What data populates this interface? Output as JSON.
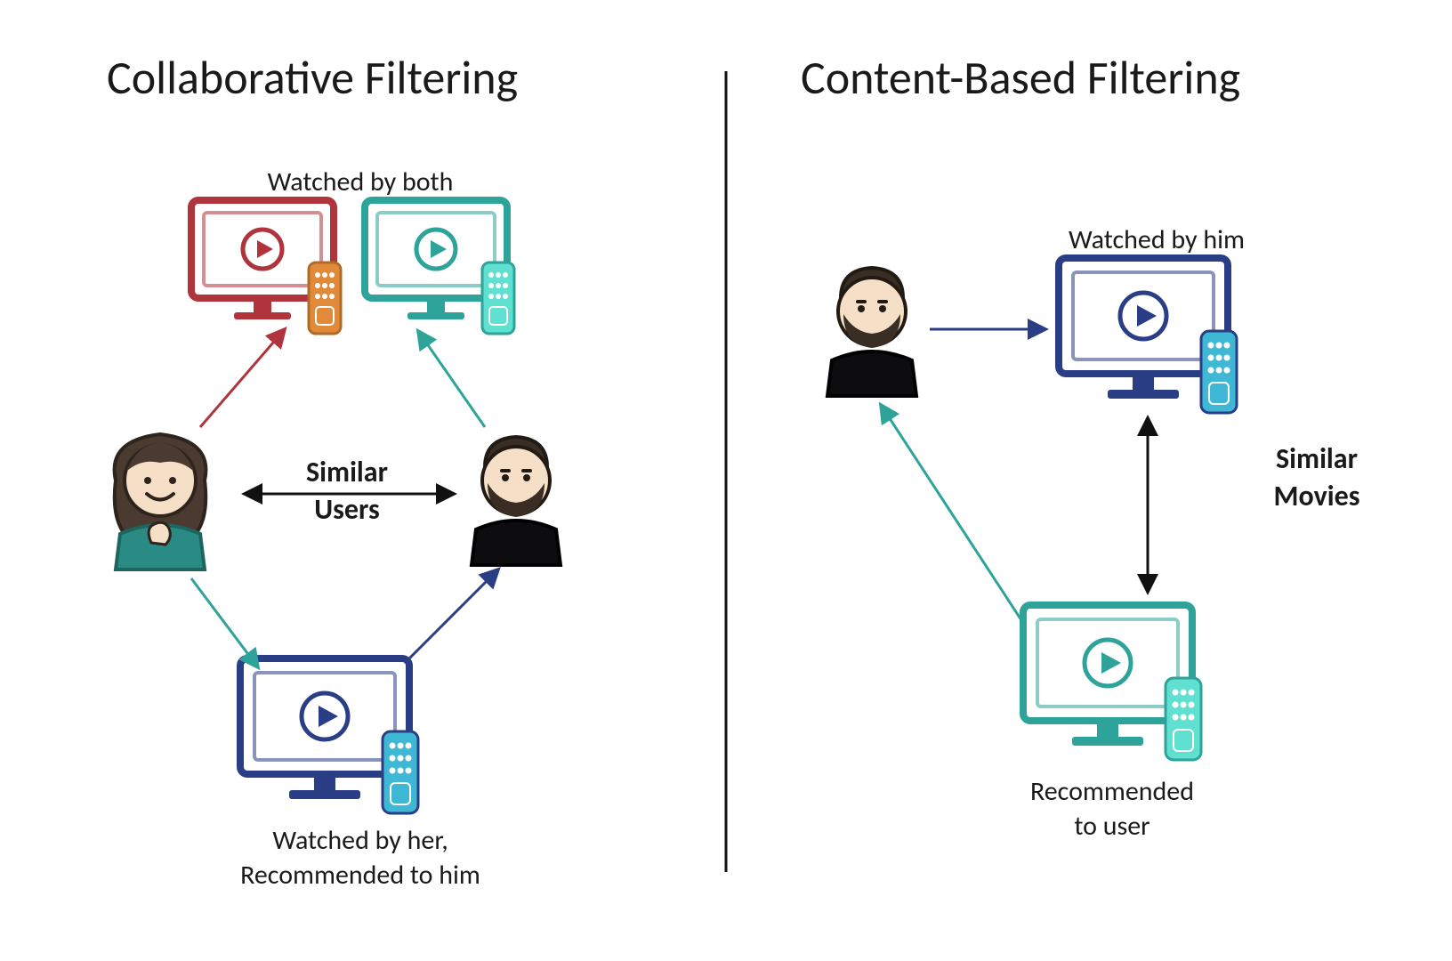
{
  "left": {
    "title": "Collaborative Filtering",
    "top_label": "Watched by both",
    "center_line1": "Similar",
    "center_line2": "Users",
    "bottom_line1": "Watched by her,",
    "bottom_line2": "Recommended to him"
  },
  "right": {
    "title": "Content-Based Filtering",
    "top_label": "Watched by him",
    "center_line1": "Similar",
    "center_line2": "Movies",
    "bottom_line1": "Recommended",
    "bottom_line2": "to user"
  },
  "colors": {
    "red": "#b0343c",
    "teal": "#2da39a",
    "navy": "#2a3e86",
    "mint": "#5fe0d0",
    "orange": "#e08a3a",
    "black": "#111111",
    "hair": "#4a3a30",
    "skin": "#f6dfc7",
    "shirt_teal": "#2a8a84",
    "shirt_black": "#0d0d10",
    "lightblue": "#3fb8d6"
  }
}
